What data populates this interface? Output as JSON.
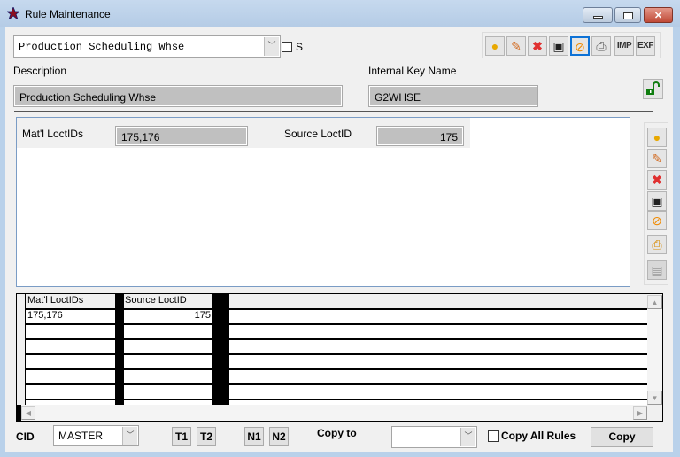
{
  "window": {
    "title": "Rule Maintenance",
    "app_icon": "star-icon",
    "controls": [
      "minimize",
      "maximize",
      "close"
    ]
  },
  "rule_selector": {
    "value": "Production Scheduling Whse",
    "s_checkbox_label": "S",
    "s_checked": false
  },
  "toolbar": {
    "buttons": [
      {
        "name": "new-icon",
        "glyph": "☀"
      },
      {
        "name": "edit-icon",
        "glyph": "✎"
      },
      {
        "name": "delete-icon",
        "glyph": "✖"
      },
      {
        "name": "save-icon",
        "glyph": "▣"
      },
      {
        "name": "cancel-icon",
        "glyph": "⊘"
      },
      {
        "name": "print-icon",
        "glyph": "⎙"
      },
      {
        "name": "import-button",
        "label": "IMP"
      },
      {
        "name": "export-button",
        "label": "EXF"
      }
    ]
  },
  "description": {
    "label": "Description",
    "value": "Production Scheduling Whse"
  },
  "internal_key": {
    "label": "Internal Key Name",
    "value": "G2WHSE"
  },
  "lock_icon": "unlocked-padlock-icon",
  "detail": {
    "matl_label": "Mat'l LoctIDs",
    "matl_value": "175,176",
    "source_label": "Source LoctID",
    "source_value": "175"
  },
  "side_toolbar": {
    "buttons": [
      "new-icon",
      "edit-icon",
      "delete-icon",
      "save-icon",
      "cancel-icon",
      "print-preview-icon",
      "paste-icon"
    ]
  },
  "grid": {
    "columns": [
      "Mat'l LoctIDs",
      "Source LoctID"
    ],
    "rows": [
      [
        "175,176",
        "175"
      ],
      [
        "",
        ""
      ],
      [
        "",
        ""
      ],
      [
        "",
        ""
      ],
      [
        "",
        ""
      ],
      [
        "",
        ""
      ]
    ]
  },
  "footer": {
    "cid_label": "CID",
    "cid_value": "MASTER",
    "t1": "T1",
    "t2": "T2",
    "n1": "N1",
    "n2": "N2",
    "copy_to_label": "Copy to",
    "copy_to_value": "",
    "copy_all_label": "Copy All Rules",
    "copy_all_checked": false,
    "copy_button": "Copy"
  },
  "colors": {
    "title_bar": "#b9d1ea",
    "readonly_field": "#c0c0c0",
    "selected_toolbar_border": "#0e72d6",
    "lock_green": "#0f7d0f",
    "close_button": "#c04a37"
  }
}
